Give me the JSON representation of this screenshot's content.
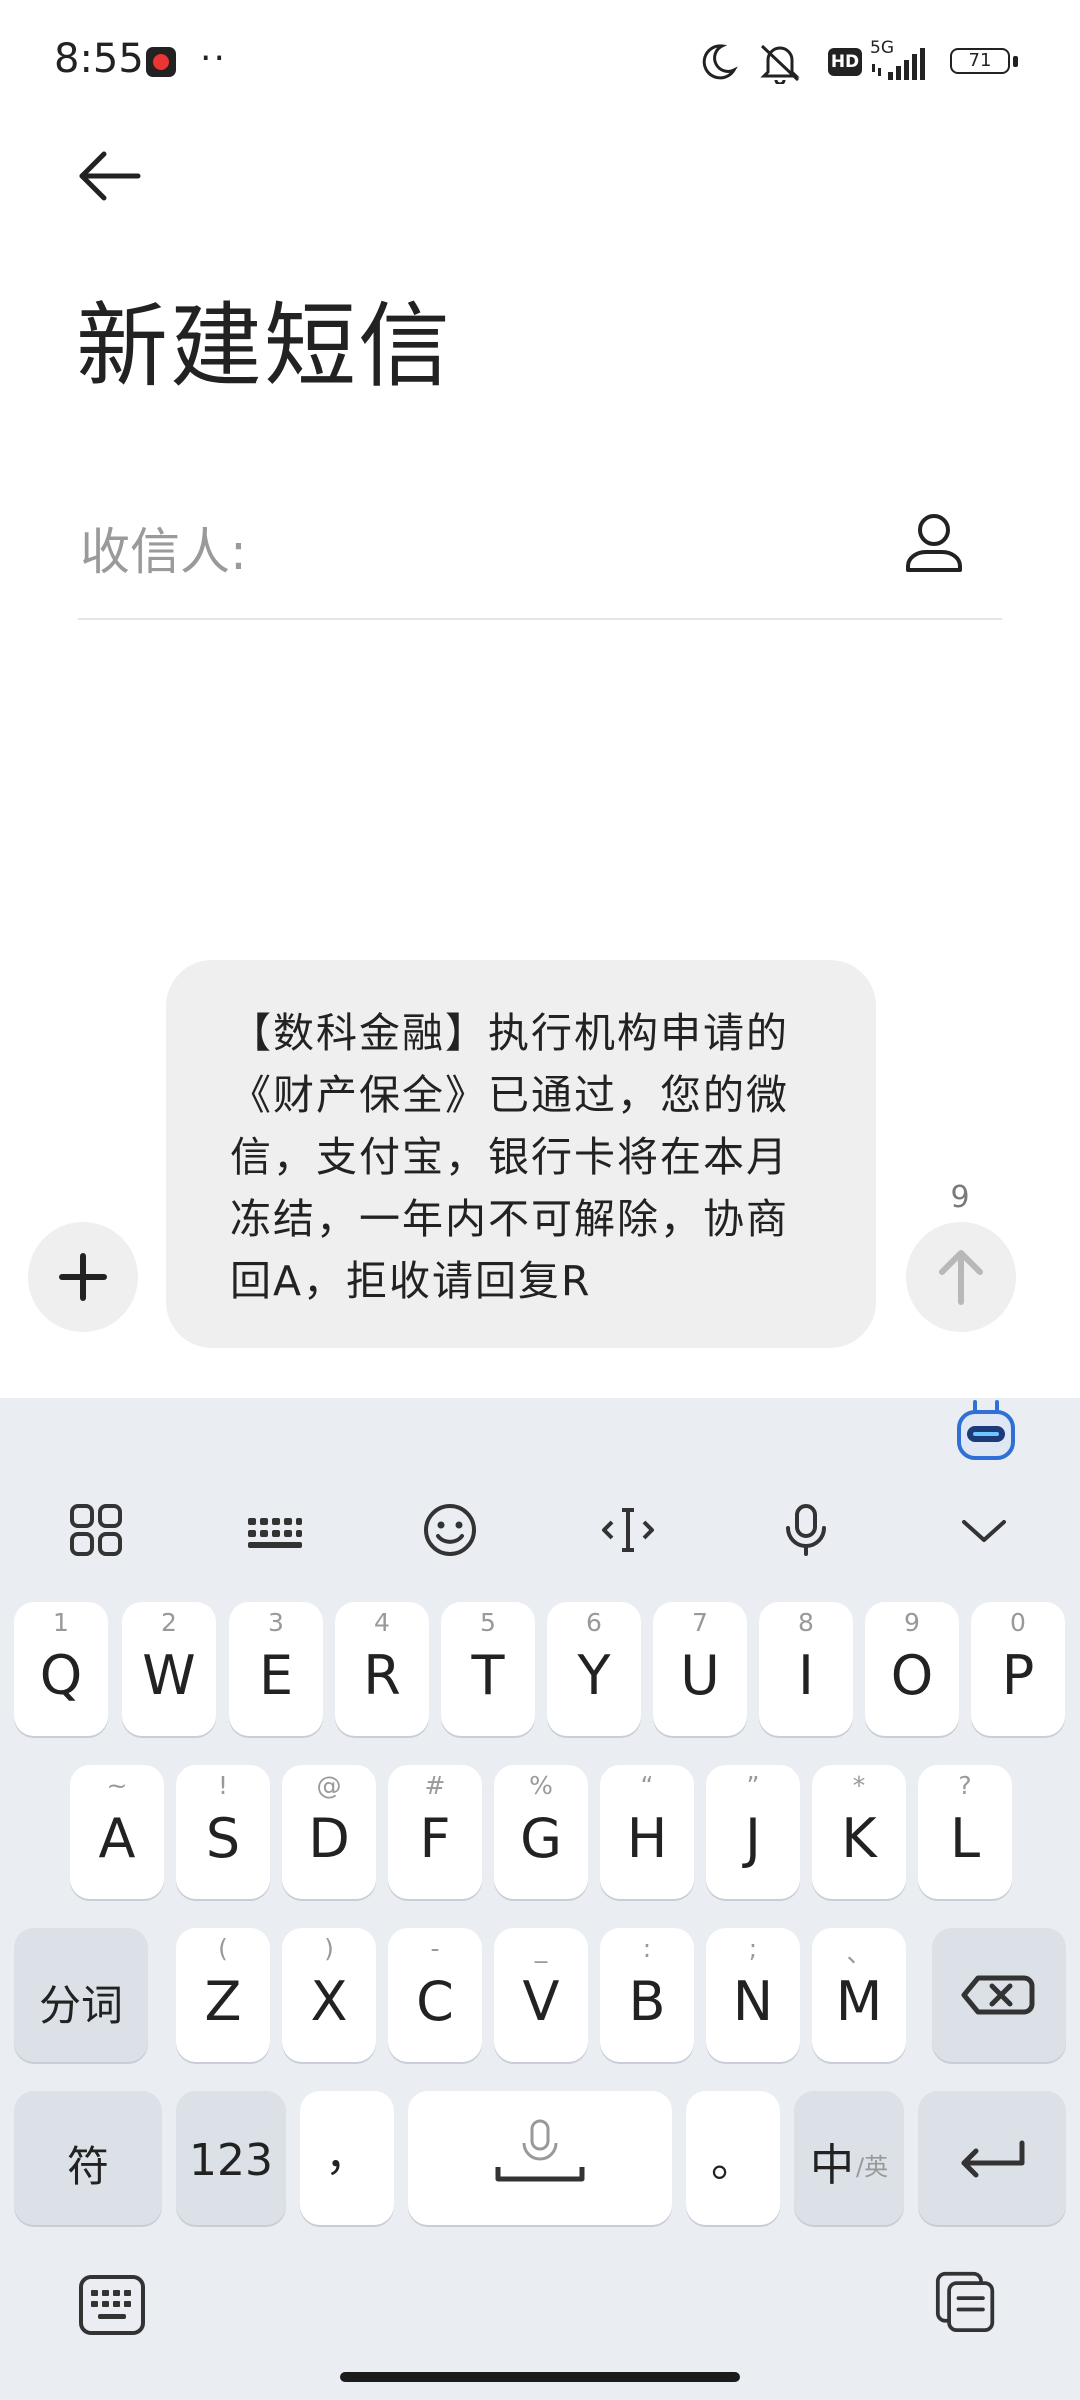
{
  "status_bar": {
    "time": "8:55",
    "dots": "··",
    "network": "5G",
    "hd_label": "HD",
    "battery_level": "71"
  },
  "header": {
    "title": "新建短信"
  },
  "recipient": {
    "label": "收信人:"
  },
  "composer": {
    "message": "【数科金融】执行机构申请的《财产保全》已通过，您的微信，支付宝，银行卡将在本月冻结，一年内不可解除，协商回A，拒收请回复R",
    "char_count": "9"
  },
  "keyboard": {
    "row1": [
      {
        "key": "Q",
        "hint": "1"
      },
      {
        "key": "W",
        "hint": "2"
      },
      {
        "key": "E",
        "hint": "3"
      },
      {
        "key": "R",
        "hint": "4"
      },
      {
        "key": "T",
        "hint": "5"
      },
      {
        "key": "Y",
        "hint": "6"
      },
      {
        "key": "U",
        "hint": "7"
      },
      {
        "key": "I",
        "hint": "8"
      },
      {
        "key": "O",
        "hint": "9"
      },
      {
        "key": "P",
        "hint": "0"
      }
    ],
    "row2": [
      {
        "key": "A",
        "hint": "~"
      },
      {
        "key": "S",
        "hint": "!"
      },
      {
        "key": "D",
        "hint": "@"
      },
      {
        "key": "F",
        "hint": "#"
      },
      {
        "key": "G",
        "hint": "%"
      },
      {
        "key": "H",
        "hint": "“"
      },
      {
        "key": "J",
        "hint": "”"
      },
      {
        "key": "K",
        "hint": "*"
      },
      {
        "key": "L",
        "hint": "?"
      }
    ],
    "row3": [
      {
        "key": "Z",
        "hint": "("
      },
      {
        "key": "X",
        "hint": ")"
      },
      {
        "key": "C",
        "hint": "-"
      },
      {
        "key": "V",
        "hint": "_"
      },
      {
        "key": "B",
        "hint": ":"
      },
      {
        "key": "N",
        "hint": ";"
      },
      {
        "key": "M",
        "hint": "、"
      }
    ],
    "segment_label": "分词",
    "symbol_label": "符",
    "numbers_label": "123",
    "comma": "，",
    "period": "。",
    "lang_main": "中",
    "lang_alt": "/英"
  }
}
